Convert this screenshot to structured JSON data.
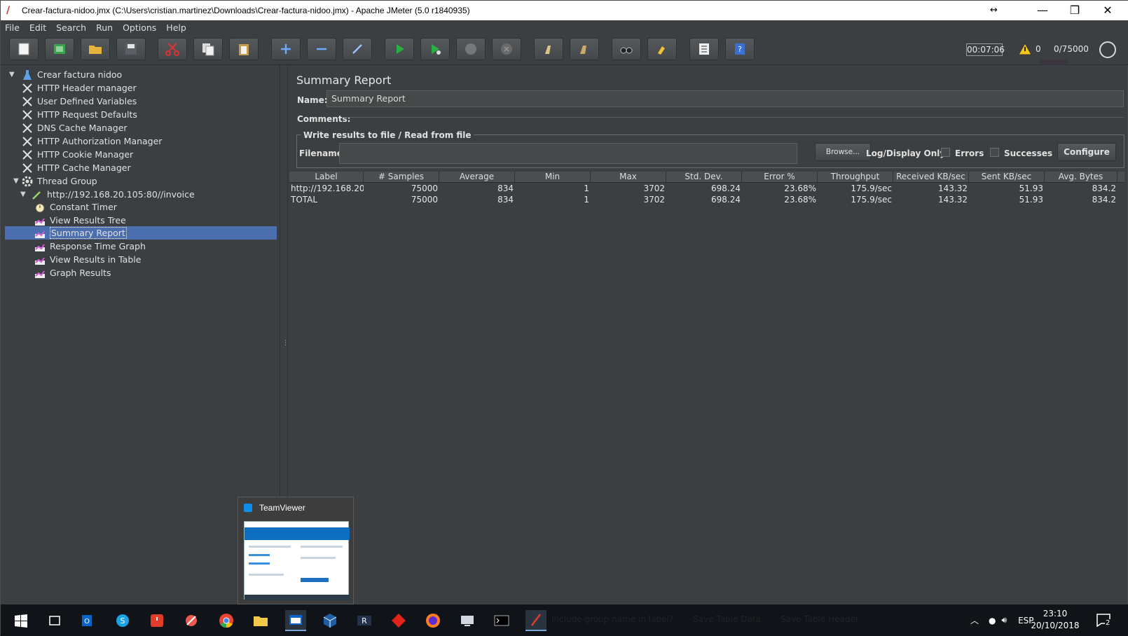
{
  "window": {
    "title": "Crear-factura-nidoo.jmx (C:\\Users\\cristian.martinez\\Downloads\\Crear-factura-nidoo.jmx) - Apache JMeter (5.0 r1840935)"
  },
  "menu": [
    "File",
    "Edit",
    "Search",
    "Run",
    "Options",
    "Help"
  ],
  "toolbar": {
    "elapsed": "00:07:06",
    "warnings": "0",
    "threads": "0/75000"
  },
  "tree": {
    "root": "Crear factura nidoo",
    "config": [
      "HTTP Header manager",
      "User Defined Variables",
      "HTTP Request Defaults",
      "DNS Cache Manager",
      "HTTP Authorization Manager",
      "HTTP Cookie Manager",
      "HTTP Cache Manager"
    ],
    "thread_group": "Thread Group",
    "sampler": "http://192.168.20.105:80//invoice",
    "children": [
      "Constant Timer",
      "View Results Tree",
      "Summary Report",
      "Response Time Graph",
      "View Results in Table",
      "Graph Results"
    ],
    "selected": "Summary Report"
  },
  "panel": {
    "title": "Summary Report",
    "name_label": "Name:",
    "name_value": "Summary Report",
    "comments_label": "Comments:",
    "file_group": "Write results to file / Read from file",
    "filename_label": "Filename",
    "browse": "Browse...",
    "log_display": "Log/Display Only:",
    "errors": "Errors",
    "successes": "Successes",
    "configure": "Configure"
  },
  "table": {
    "headers": [
      "Label",
      "# Samples",
      "Average",
      "Min",
      "Max",
      "Std. Dev.",
      "Error %",
      "Throughput",
      "Received KB/sec",
      "Sent KB/sec",
      "Avg. Bytes"
    ],
    "rows": [
      [
        "http://192.168.20....",
        "75000",
        "834",
        "1",
        "3702",
        "698.24",
        "23.68%",
        "175.9/sec",
        "143.32",
        "51.93",
        "834.2"
      ],
      [
        "TOTAL",
        "75000",
        "834",
        "1",
        "3702",
        "698.24",
        "23.68%",
        "175.9/sec",
        "143.32",
        "51.93",
        "834.2"
      ]
    ]
  },
  "teamviewer": {
    "title": "TeamViewer"
  },
  "taskbar": {
    "hidden_options": [
      "Include group name in label?",
      "Save Table Data",
      "Save Table Header"
    ],
    "language": "ESP",
    "time": "23:10",
    "date": "20/10/2018",
    "notifications": "2"
  }
}
